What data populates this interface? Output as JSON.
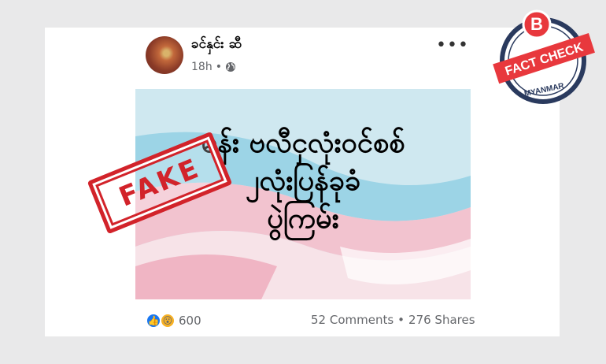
{
  "post": {
    "author": "ခင်နှင်း ဆီ",
    "time": "18h",
    "more_icon": "more-horizontal-icon",
    "privacy_icon": "globe-icon",
    "image": {
      "lines": [
        "မန်း ဗလီငှလုံးဝင်စစ်",
        "၂လုံးပြန်ခုခံ",
        "ပွဲကြမ်း"
      ],
      "stamp": "FAKE"
    },
    "reaction_icons": [
      "like-icon",
      "wow-icon"
    ],
    "reaction_count": "600",
    "comments": "52 Comments",
    "separator": "•",
    "shares": "276 Shares"
  },
  "badge": {
    "letter": "B",
    "label": "FACT CHECK",
    "sublabel": "MYANMAR",
    "color": "#e8383d",
    "ring_color": "#2a3a5e"
  }
}
